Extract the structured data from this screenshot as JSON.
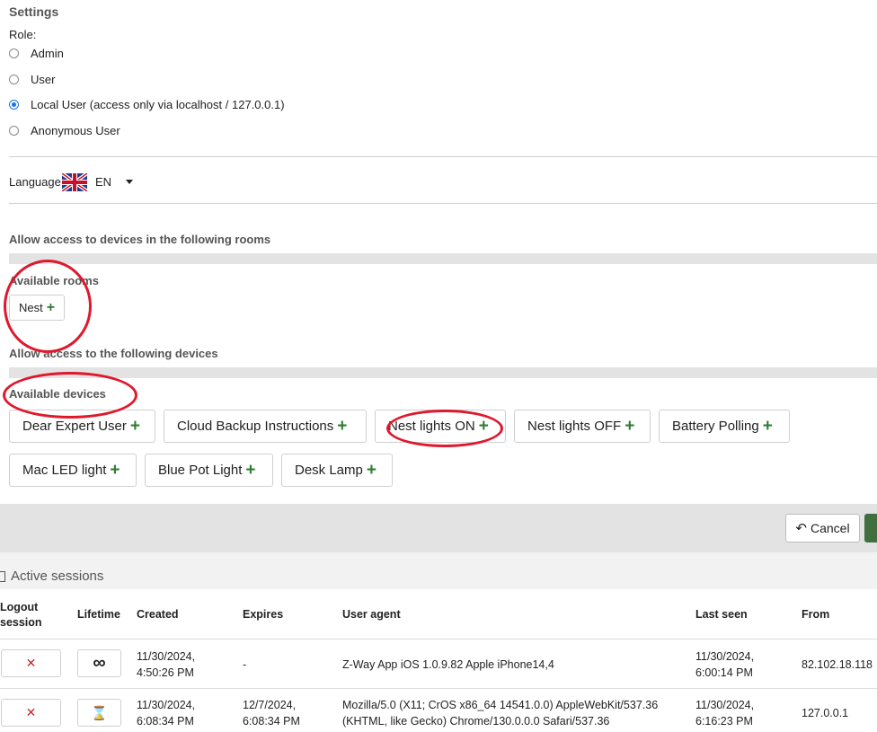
{
  "settings": {
    "title": "Settings",
    "role_label": "Role:",
    "roles": [
      {
        "label": "Admin",
        "selected": false
      },
      {
        "label": "User",
        "selected": false
      },
      {
        "label": "Local User (access only via localhost / 127.0.0.1)",
        "selected": true
      },
      {
        "label": "Anonymous User",
        "selected": false
      }
    ],
    "language_label": "Language:",
    "language_value": "EN"
  },
  "rooms": {
    "heading": "Allow access to devices in the following rooms",
    "available_label": "Available rooms",
    "items": [
      "Nest"
    ]
  },
  "devices": {
    "heading": "Allow access to the following devices",
    "available_label": "Available devices",
    "items": [
      "Dear Expert User",
      "Cloud Backup Instructions",
      "Nest lights ON",
      "Nest lights OFF",
      "Battery Polling",
      "Mac LED light",
      "Blue Pot Light",
      "Desk Lamp"
    ]
  },
  "actions": {
    "cancel_label": "Cancel"
  },
  "sessions": {
    "title": "Active sessions",
    "headers": {
      "logout_1": "Logout",
      "logout_2": "session",
      "lifetime": "Lifetime",
      "created": "Created",
      "expires": "Expires",
      "user_agent": "User agent",
      "last_seen": "Last seen",
      "from": "From"
    },
    "rows": [
      {
        "created_1": "11/30/2024,",
        "created_2": "4:50:26 PM",
        "expires_1": "-",
        "expires_2": "",
        "ua_1": "Z-Way App iOS 1.0.9.82 Apple iPhone14,4",
        "ua_2": "",
        "last_1": "11/30/2024,",
        "last_2": "6:00:14 PM",
        "from": "82.102.18.118",
        "lifetime_icon": "infinity-icon"
      },
      {
        "created_1": "11/30/2024,",
        "created_2": "6:08:34 PM",
        "expires_1": "12/7/2024,",
        "expires_2": "6:08:34 PM",
        "ua_1": "Mozilla/5.0 (X11; CrOS x86_64 14541.0.0) AppleWebKit/537.36",
        "ua_2": "(KHTML, like Gecko) Chrome/130.0.0.0 Safari/537.36",
        "last_1": "11/30/2024,",
        "last_2": "6:16:23 PM",
        "from": "127.0.0.1",
        "lifetime_icon": "hourglass-icon"
      }
    ]
  },
  "colors": {
    "accent_green": "#2e7d32",
    "annotation_red": "#e0182d",
    "radio_blue": "#1a73e8"
  }
}
